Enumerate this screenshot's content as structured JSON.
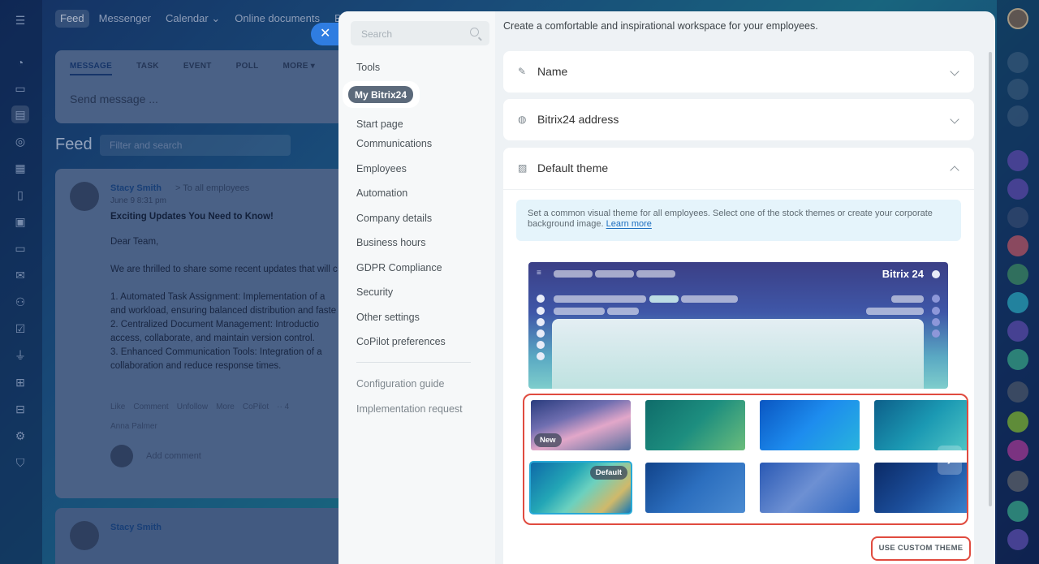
{
  "topnav": [
    "Feed",
    "Messenger",
    "Calendar ⌄",
    "Online documents",
    "Boa"
  ],
  "composer": {
    "tabs": [
      "MESSAGE",
      "TASK",
      "EVENT",
      "POLL",
      "MORE ▾"
    ],
    "placeholder": "Send message ..."
  },
  "feed": {
    "title": "Feed",
    "search_placeholder": "Filter and search"
  },
  "post": {
    "author": "Stacy Smith",
    "to": "> To all employees",
    "date": "June 9 8:31 pm",
    "title": "Exciting Updates You Need to Know!",
    "body": "Dear Team,\n\nWe are thrilled to share some recent updates that will c\n\n1. Automated Task Assignment: Implementation of a\nand workload, ensuring balanced distribution and faste\n2. Centralized Document Management: Introductio\naccess, collaborate, and maintain version control.\n3. Enhanced Communication Tools: Integration of a\ncollaboration and reduce response times.",
    "actions": [
      "Like",
      "Comment",
      "Unfollow",
      "More",
      "CoPilot",
      "·· 4"
    ],
    "liker": "Anna Palmer",
    "comment_placeholder": "Add comment"
  },
  "post2": {
    "author": "Stacy Smith"
  },
  "settings": {
    "search_placeholder": "Search",
    "menu": [
      "Tools",
      "My Bitrix24",
      "Start page",
      "Communications",
      "Employees",
      "Automation",
      "Company details",
      "Business hours",
      "GDPR Compliance",
      "Security",
      "Other settings",
      "CoPilot preferences"
    ],
    "menu_secondary": [
      "Configuration guide",
      "Implementation request"
    ],
    "intro": "Create a comfortable and inspirational workspace for your employees.",
    "sections": {
      "name": "Name",
      "address": "Bitrix24 address",
      "theme": "Default theme"
    },
    "theme_info": "Set a common visual theme for all employees. Select one of the stock themes or create your corporate background image.",
    "learn_more": "Learn more",
    "preview_logo": "Bitrix 24",
    "tag_new": "New",
    "tag_default": "Default",
    "custom_button": "USE CUSTOM THEME"
  },
  "colors": {
    "accent": "#2f7de1",
    "highlight": "#e04b3f",
    "selected_theme": "#27a9d6"
  }
}
